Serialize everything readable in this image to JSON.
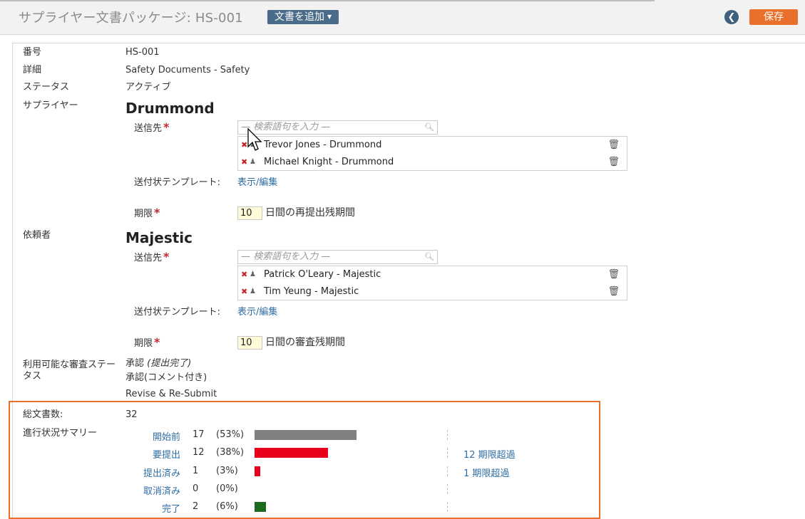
{
  "header": {
    "title": "サプライヤー文書パッケージ: HS-001",
    "add_document_label": "文書を追加",
    "back_icon": "chevron-left-icon",
    "save_label": "保存"
  },
  "fields": {
    "number_label": "番号",
    "number_value": "HS-001",
    "detail_label": "詳細",
    "detail_value": "Safety Documents - Safety",
    "status_label": "ステータス",
    "status_value": "アクティブ"
  },
  "supplier": {
    "section_label": "サプライヤー",
    "name": "Drummond",
    "send_to_label": "送信先",
    "search_placeholder": "— 検索語句を入力 —",
    "recipients": [
      "Trevor Jones - Drummond",
      "Michael Knight - Drummond"
    ],
    "cover_template_label": "送付状テンプレート:",
    "cover_template_link": "表示/編集",
    "deadline_label": "期限",
    "deadline_value": "10",
    "deadline_suffix": "日間の再提出残期間"
  },
  "requester": {
    "section_label": "依頼者",
    "name": "Majestic",
    "send_to_label": "送信先",
    "search_placeholder": "— 検索語句を入力 —",
    "recipients": [
      "Patrick O'Leary - Majestic",
      "Tim Yeung - Majestic"
    ],
    "cover_template_label": "送付状テンプレート:",
    "cover_template_link": "表示/編集",
    "deadline_label": "期限",
    "deadline_value": "10",
    "deadline_suffix": "日間の審査残期間"
  },
  "review_statuses": {
    "label": "利用可能な審査ステータス",
    "items": [
      {
        "text": "承認",
        "emph": "(提出完了)"
      },
      {
        "text": "承認(コメント付き)",
        "emph": ""
      },
      {
        "text": "Revise & Re-Submit",
        "emph": ""
      }
    ]
  },
  "summary": {
    "total_label": "総文書数:",
    "total_value": "32",
    "progress_label": "進行状況サマリー",
    "rows": [
      {
        "label": "開始前",
        "count": "17",
        "pct": "(53%)",
        "fraction": 0.53,
        "color": "#808080",
        "overdue": ""
      },
      {
        "label": "要提出",
        "count": "12",
        "pct": "(38%)",
        "fraction": 0.38,
        "color": "#e8001c",
        "overdue": "12 期限超過"
      },
      {
        "label": "提出済み",
        "count": "1",
        "pct": "(3%)",
        "fraction": 0.03,
        "color": "#e8001c",
        "overdue": "1 期限超過"
      },
      {
        "label": "取消済み",
        "count": "0",
        "pct": "(0%)",
        "fraction": 0.0,
        "color": "#808080",
        "overdue": ""
      },
      {
        "label": "完了",
        "count": "2",
        "pct": "(6%)",
        "fraction": 0.06,
        "color": "#1e6b1e",
        "overdue": ""
      }
    ]
  }
}
